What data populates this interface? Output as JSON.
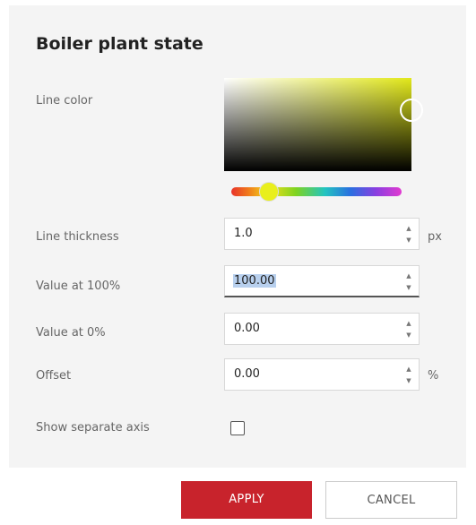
{
  "dialog": {
    "title": "Boiler plant state",
    "line_color": {
      "label": "Line color",
      "selected_color": "#e2e81a",
      "hue_color": "#e9ef1c"
    },
    "line_thickness": {
      "label": "Line thickness",
      "value": "1.0",
      "unit": "px"
    },
    "value_100": {
      "label": "Value at 100%",
      "value": "100.00"
    },
    "value_0": {
      "label": "Value at 0%",
      "value": "0.00"
    },
    "offset": {
      "label": "Offset",
      "value": "0.00",
      "unit": "%"
    },
    "separate_axis": {
      "label": "Show separate axis",
      "checked": false
    }
  },
  "buttons": {
    "apply": "APPLY",
    "cancel": "CANCEL"
  },
  "colors": {
    "accent": "#c8232c",
    "panel_bg": "#f4f4f4"
  },
  "icons": {
    "spin_up": "▲",
    "spin_down": "▼"
  }
}
